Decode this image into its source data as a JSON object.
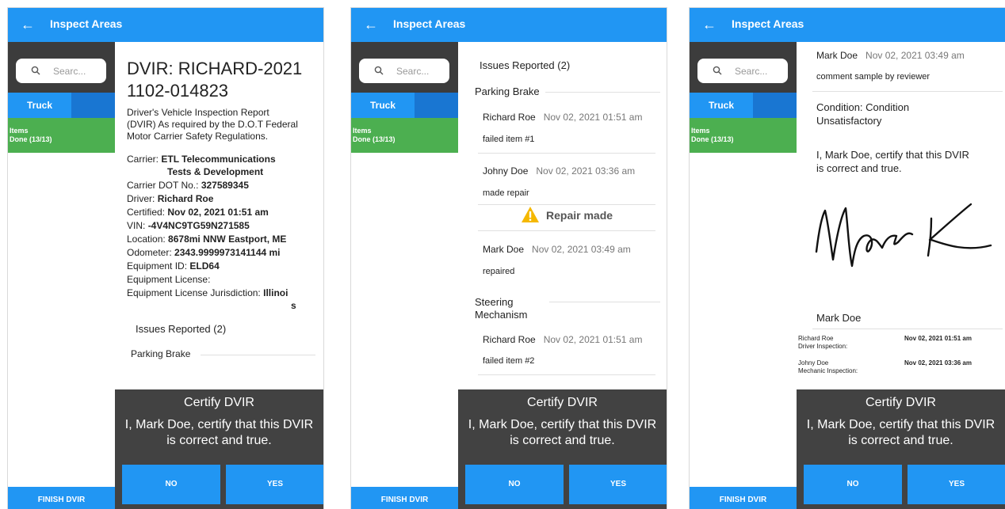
{
  "app_title": "Inspect Areas",
  "sidebar": {
    "search_placeholder": "Searc...",
    "tab_truck": "Truck",
    "items_line1": "Items",
    "items_line2": "Done (13/13)",
    "finish_button": "FINISH DVIR"
  },
  "sheet": {
    "title": "Certify DVIR",
    "text": "I, Mark Doe, certify that this DVIR is correct and true.",
    "no_button": "NO",
    "yes_button": "YES"
  },
  "screen1": {
    "title_line1": "DVIR: RICHARD-2021",
    "title_line2": "1102-014823",
    "desc1": "Driver's Vehicle Inspection Report",
    "desc2": "(DVIR) As required by the D.O.T Federal",
    "desc3": "Motor Carrier Safety Regulations.",
    "carrier_label": "Carrier:",
    "carrier_value1": "ETL Telecommunications",
    "carrier_value2": "Tests & Development",
    "dot_label": "Carrier DOT No.:",
    "dot_value": "327589345",
    "driver_label": "Driver:",
    "driver_value": "Richard Roe",
    "certified_label": "Certified:",
    "certified_value": "Nov 02, 2021  01:51 am",
    "vin_label": "VIN:",
    "vin_value": "-4V4NC9TG59N271585",
    "location_label": "Location:",
    "location_value": "8678mi NNW Eastport, ME",
    "odometer_label": "Odometer:",
    "odometer_value": "2343.9999973141144 mi",
    "equipment_id_label": "Equipment ID:",
    "equipment_id_value": "ELD64",
    "equipment_license_label": "Equipment License:",
    "jurisdiction_label": "Equipment License Jurisdiction:",
    "jurisdiction_value1": "Illinoi",
    "jurisdiction_value2": "s",
    "issues_header": "Issues Reported (2)",
    "parking_brake": "Parking Brake"
  },
  "screen2": {
    "issues_header": "Issues Reported (2)",
    "parking_brake": "Parking Brake",
    "c1_name": "Richard Roe",
    "c1_date": "Nov 02, 2021  01:51 am",
    "c1_text": "failed item #1",
    "c2_name": "Johny Doe",
    "c2_date": "Nov 02, 2021  03:36 am",
    "c2_text": "made repair",
    "repair_made": "Repair made",
    "c3_name": "Mark Doe",
    "c3_date": "Nov 02, 2021  03:49 am",
    "c3_text": "repaired",
    "steering1": "Steering",
    "steering2": "Mechanism",
    "c4_name": "Richard Roe",
    "c4_date": "Nov 02, 2021  01:51 am",
    "c4_text": "failed item #2"
  },
  "screen3": {
    "name": "Mark Doe",
    "date": "Nov 02, 2021  03:49 am",
    "comment": "comment sample by reviewer",
    "condition1": "Condition: Condition",
    "condition2": "Unsatisfactory",
    "certify1": "I, Mark Doe, certify that this DVIR",
    "certify2": "is correct and true.",
    "signer_name": "Mark Doe",
    "driver_name": "Richard Roe",
    "driver_role": "Driver Inspection:",
    "driver_date": "Nov 02, 2021  01:51 am",
    "mechanic_name": "Johny Doe",
    "mechanic_role": "Mechanic Inspection:",
    "mechanic_date": "Nov 02, 2021  03:36 am"
  },
  "colors": {
    "accent": "#2196f3",
    "success": "#4caf50",
    "sheet": "#424242",
    "warning": "#f5b800"
  }
}
